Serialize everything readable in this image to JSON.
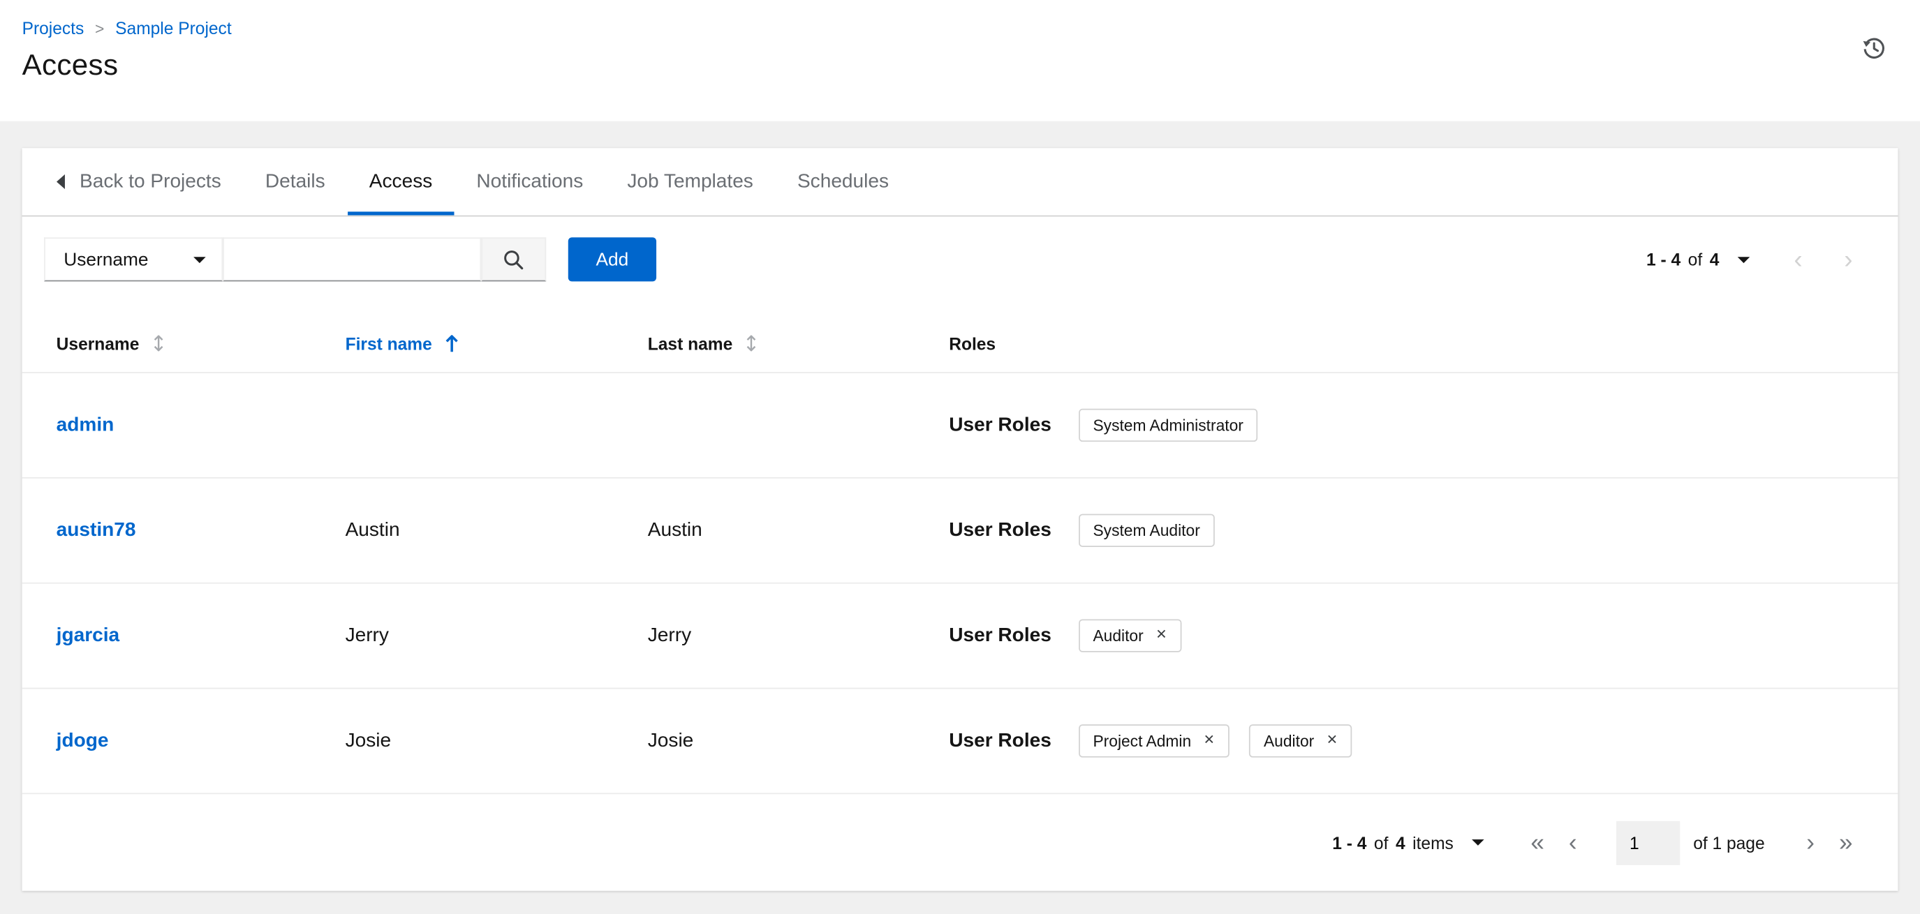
{
  "colors": {
    "accent": "#0066cc"
  },
  "breadcrumb": {
    "items": [
      {
        "label": "Projects"
      },
      {
        "label": "Sample Project"
      }
    ],
    "separator": ">"
  },
  "page": {
    "title": "Access"
  },
  "tabs": {
    "back_label": "Back to Projects",
    "items": [
      {
        "label": "Details",
        "active": false
      },
      {
        "label": "Access",
        "active": true
      },
      {
        "label": "Notifications",
        "active": false
      },
      {
        "label": "Job Templates",
        "active": false
      },
      {
        "label": "Schedules",
        "active": false
      }
    ]
  },
  "toolbar": {
    "filter_dropdown": {
      "value": "Username"
    },
    "search": {
      "value": ""
    },
    "add_label": "Add",
    "pagination": {
      "range": "1 - 4",
      "of": "of",
      "total": "4"
    }
  },
  "table": {
    "columns": [
      {
        "label": "Username",
        "sortable": true,
        "sorted": null
      },
      {
        "label": "First name",
        "sortable": true,
        "sorted": "ascending"
      },
      {
        "label": "Last name",
        "sortable": true,
        "sorted": null
      },
      {
        "label": "Roles",
        "sortable": false,
        "sorted": null
      }
    ],
    "roles_label": "User Roles",
    "rows": [
      {
        "username": "admin",
        "first_name": "",
        "last_name": "",
        "roles": [
          {
            "label": "System Administrator",
            "removable": false
          }
        ]
      },
      {
        "username": "austin78",
        "first_name": "Austin",
        "last_name": "Austin",
        "roles": [
          {
            "label": "System Auditor",
            "removable": false
          }
        ]
      },
      {
        "username": "jgarcia",
        "first_name": "Jerry",
        "last_name": "Jerry",
        "roles": [
          {
            "label": "Auditor",
            "removable": true
          }
        ]
      },
      {
        "username": "jdoge",
        "first_name": "Josie",
        "last_name": "Josie",
        "roles": [
          {
            "label": "Project Admin",
            "removable": true
          },
          {
            "label": "Auditor",
            "removable": true
          }
        ]
      }
    ]
  },
  "footer": {
    "pagination": {
      "range": "1 - 4",
      "of": "of",
      "total": "4",
      "items_label": "items",
      "current_page": "1",
      "page_count_label": "of 1 page"
    }
  },
  "icons": {
    "first_page": "«",
    "previous_page": "‹",
    "next_page": "›",
    "last_page": "»",
    "remove": "✕"
  }
}
